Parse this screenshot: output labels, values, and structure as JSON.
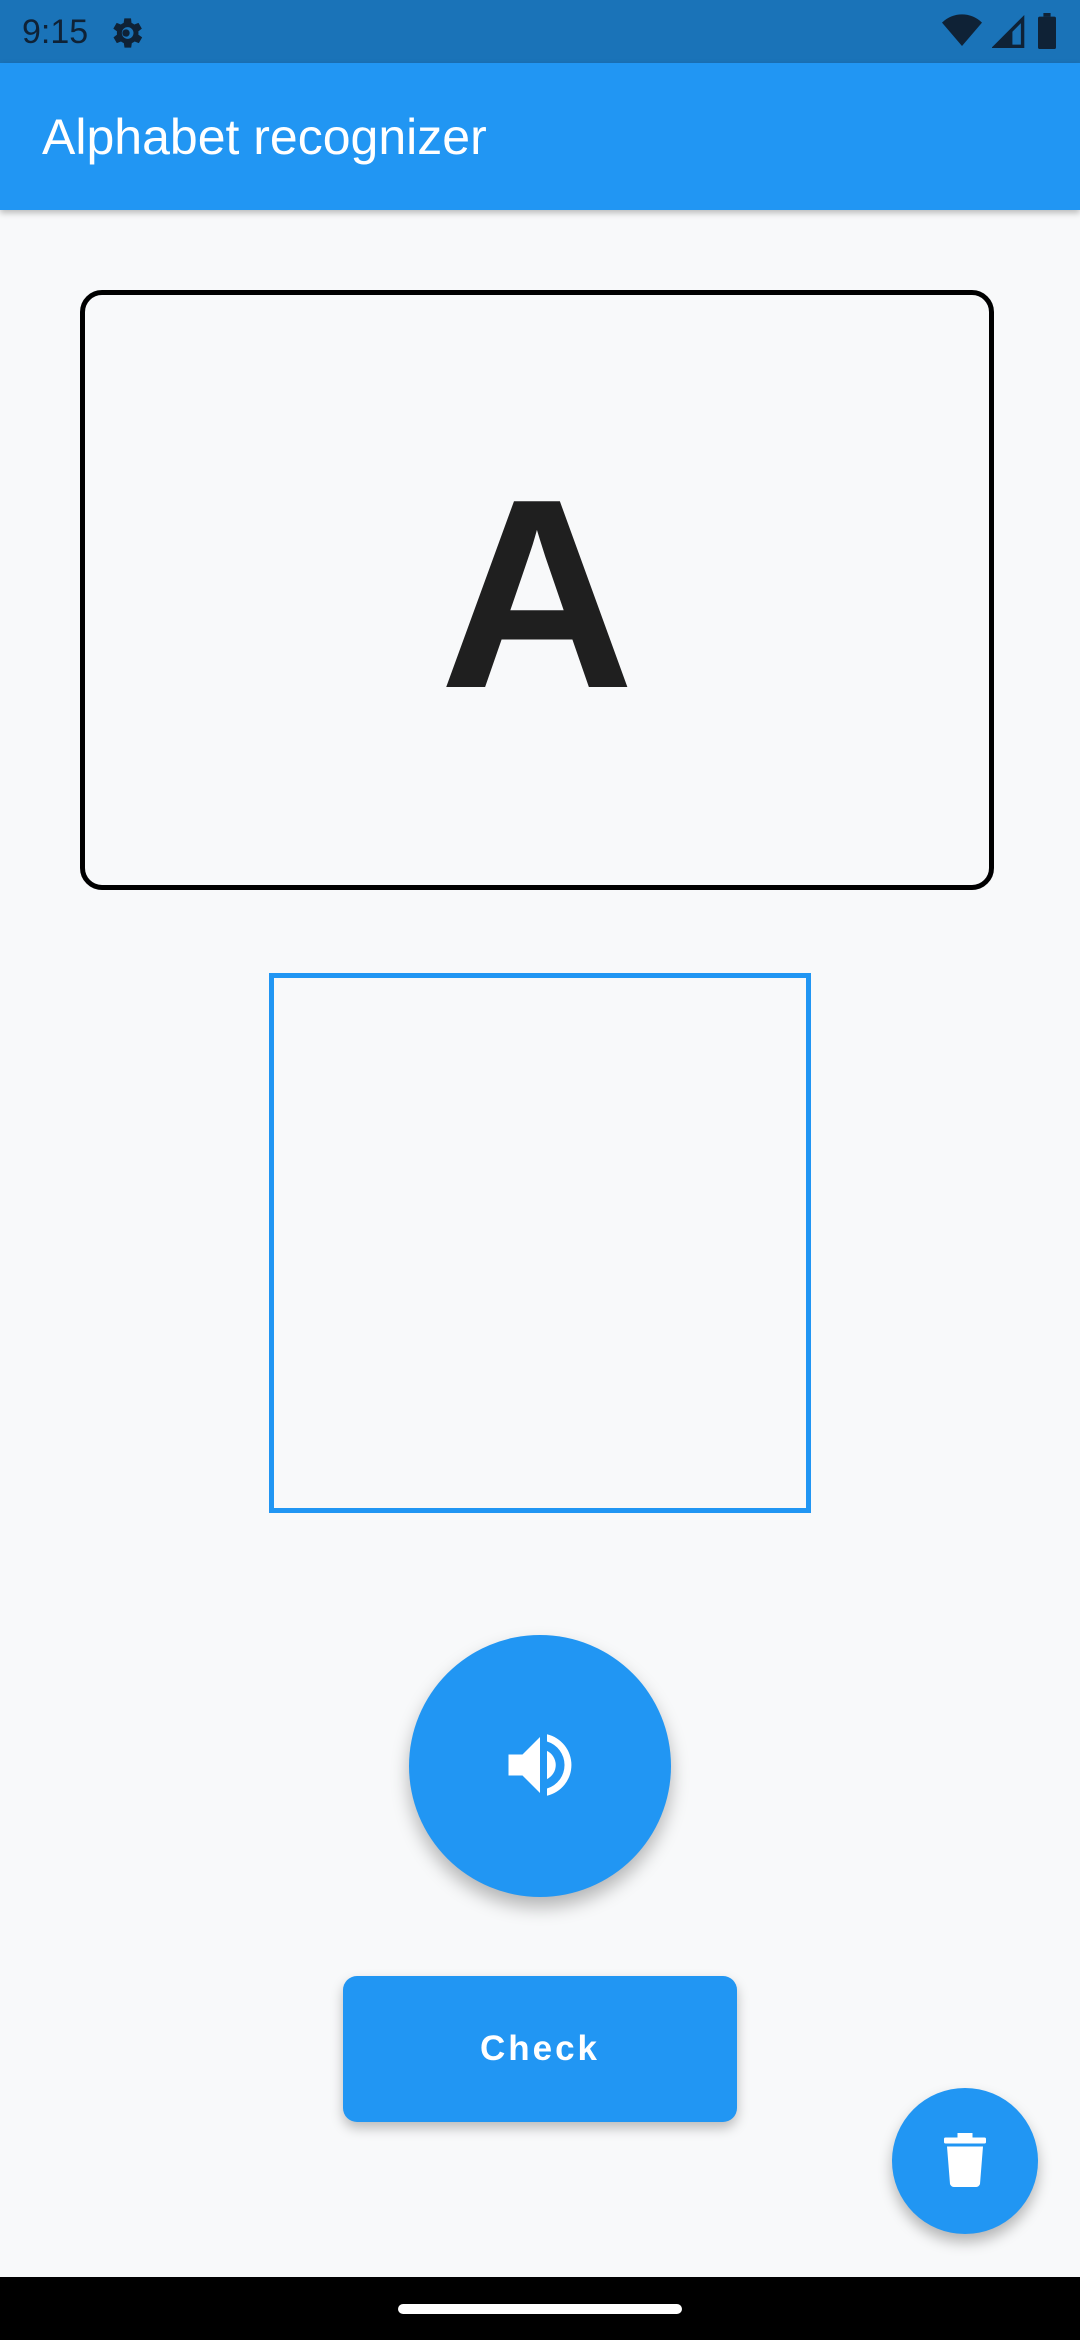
{
  "status_bar": {
    "time": "9:15",
    "icons": [
      "settings-gear-icon",
      "wifi-icon",
      "signal-icon",
      "battery-icon"
    ]
  },
  "app_bar": {
    "title": "Alphabet recognizer"
  },
  "letter_card": {
    "letter": "A"
  },
  "draw_pad": {
    "state": "empty"
  },
  "speak_button": {
    "icon": "volume-up-icon"
  },
  "check_button": {
    "label": "Check"
  },
  "delete_fab": {
    "icon": "trash-icon"
  },
  "colors": {
    "primary": "#2196f3",
    "status_bar": "#1a73b8",
    "background": "#f8f9fa",
    "letter": "#1f1f1f"
  }
}
